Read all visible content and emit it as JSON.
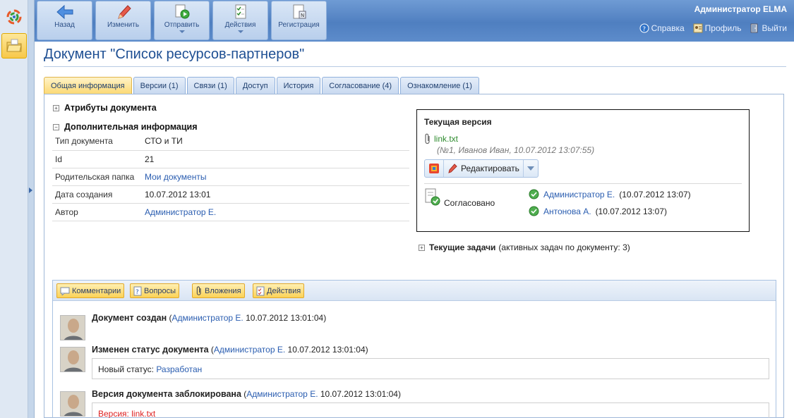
{
  "toolbar": {
    "back": "Назад",
    "edit": "Изменить",
    "send": "Отправить",
    "actions": "Действия",
    "register": "Регистрация"
  },
  "user": {
    "name": "Администратор ELMA",
    "help": "Справка",
    "profile": "Профиль",
    "logout": "Выйти"
  },
  "page": {
    "title": "Документ \"Список ресурсов-партнеров\""
  },
  "tabs": [
    {
      "label": "Общая информация"
    },
    {
      "label": "Версии (1)"
    },
    {
      "label": "Связи (1)"
    },
    {
      "label": "Доступ"
    },
    {
      "label": "История"
    },
    {
      "label": "Согласование (4)"
    },
    {
      "label": "Ознакомление (1)"
    }
  ],
  "sections": {
    "attributes": "Атрибуты документа",
    "additional": "Дополнительная информация"
  },
  "attributes": [
    {
      "key": "Тип документа",
      "value": "СТО и ТИ"
    },
    {
      "key": "Id",
      "value": "21"
    },
    {
      "key": "Родительская папка",
      "value": "Мои документы"
    },
    {
      "key": "Дата создания",
      "value": "10.07.2012 13:01"
    },
    {
      "key": "Автор",
      "value": "Администратор Е."
    }
  ],
  "current_version": {
    "title": "Текущая версия",
    "file": "link.txt",
    "meta": "(№1, Иванов Иван, 10.07.2012 13:07:55)",
    "edit_label": "Редактировать",
    "status": "Согласовано",
    "approvals": [
      {
        "name": "Администратор Е.",
        "date": "(10.07.2012 13:07)"
      },
      {
        "name": "Антонова А.",
        "date": "(10.07.2012 13:07)"
      }
    ]
  },
  "tasks": {
    "label": "Текущие задачи",
    "note": "(активных задач по документу: 3)"
  },
  "comments_bar": {
    "comments": "Комментарии",
    "questions": "Вопросы",
    "attachments": "Вложения",
    "actions": "Действия"
  },
  "entries": [
    {
      "title": "Документ создан",
      "author": "Администратор Е.",
      "date": "10.07.2012 13:01:04"
    },
    {
      "title": "Изменен статус документа",
      "author": "Администратор Е.",
      "date": "10.07.2012 13:01:04",
      "detail_label": "Новый статус:",
      "detail_value": "Разработан"
    },
    {
      "title": "Версия документа заблокирована",
      "author": "Администратор Е.",
      "date": "10.07.2012 13:01:04",
      "detail_label": "Версия:",
      "detail_value": "link.txt"
    }
  ]
}
